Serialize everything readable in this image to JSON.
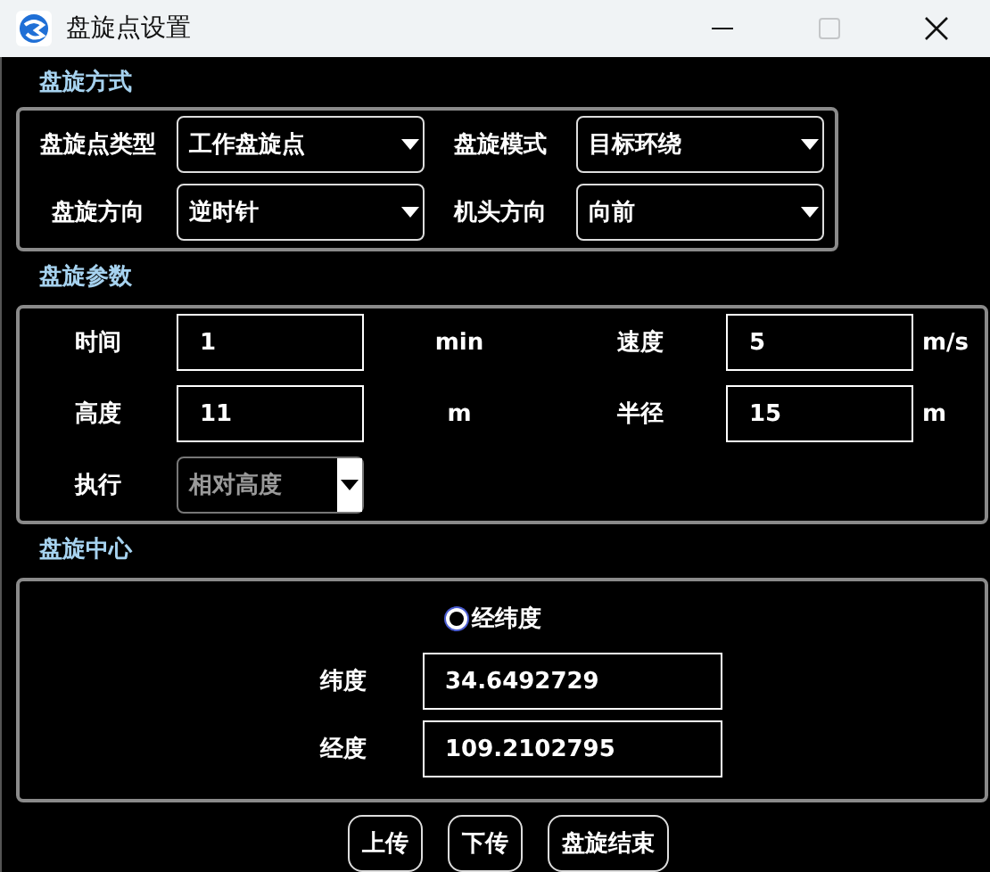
{
  "window": {
    "title": "盘旋点设置",
    "maximize_disabled": true
  },
  "mode_group": {
    "title": "盘旋方式",
    "fields": [
      {
        "label": "盘旋点类型",
        "value": "工作盘旋点"
      },
      {
        "label": "盘旋模式",
        "value": "目标环绕"
      },
      {
        "label": "盘旋方向",
        "value": "逆时针"
      },
      {
        "label": "机头方向",
        "value": "向前"
      }
    ]
  },
  "params_group": {
    "title": "盘旋参数",
    "fields": [
      {
        "kind": "input",
        "label": "时间",
        "value": "1",
        "unit": "min"
      },
      {
        "kind": "input",
        "label": "速度",
        "value": "5",
        "unit": "m/s"
      },
      {
        "kind": "input",
        "label": "高度",
        "value": "11",
        "unit": "m"
      },
      {
        "kind": "input",
        "label": "半径",
        "value": "15",
        "unit": "m"
      },
      {
        "kind": "combo",
        "label": "执行",
        "value": "相对高度",
        "disabled": true
      }
    ]
  },
  "center_group": {
    "title": "盘旋中心",
    "radio": {
      "label": "经纬度",
      "selected": false
    },
    "fields": [
      {
        "label": "纬度",
        "value": "34.6492729"
      },
      {
        "label": "经度",
        "value": "109.2102795"
      }
    ]
  },
  "buttons": [
    "上传",
    "下传",
    "盘旋结束"
  ]
}
